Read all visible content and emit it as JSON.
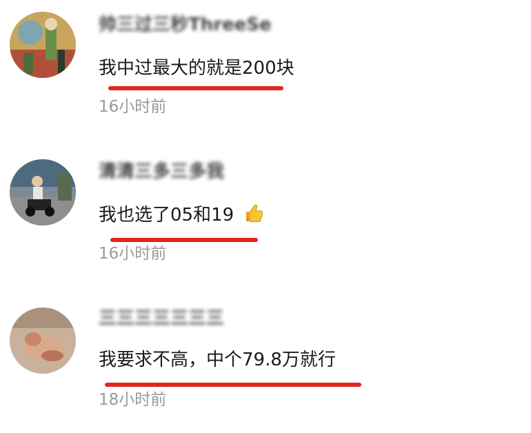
{
  "comments": [
    {
      "username": "帅三过三秒ThreeSe",
      "text": "我中过最大的就是200块",
      "time": "16小时前"
    },
    {
      "username": "清清三多三多我",
      "text": "我也选了05和19",
      "emoji": "thumbs-up-icon",
      "time": "16小时前"
    },
    {
      "username": "三三三三三三三",
      "text": "我要求不高，中个79.8万就行",
      "time": "18小时前"
    }
  ],
  "colors": {
    "underline": "#e0261b",
    "time": "#9a9a9a",
    "text": "#1a1a1a"
  }
}
